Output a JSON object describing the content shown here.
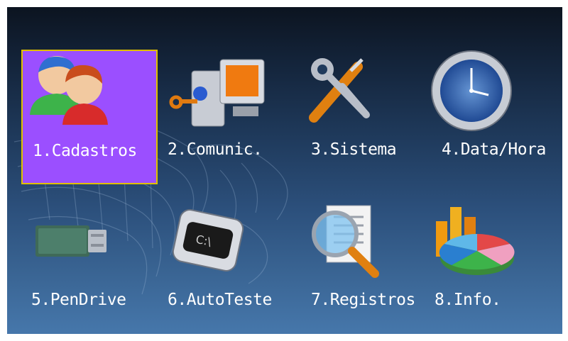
{
  "colors": {
    "selection_fill": "#9b4fff",
    "selection_border": "#e0c000",
    "label_text": "#ffffff",
    "background_top": "#0c1420",
    "background_bottom": "#4677ab"
  },
  "menu": {
    "selected_index": 0,
    "items": [
      {
        "label": "1.Cadastros",
        "icon": "users-icon"
      },
      {
        "label": "2.Comunic.",
        "icon": "network-computer-icon"
      },
      {
        "label": "3.Sistema",
        "icon": "wrench-screwdriver-icon"
      },
      {
        "label": "4.Data/Hora",
        "icon": "clock-icon"
      },
      {
        "label": "5.PenDrive",
        "icon": "usb-drive-icon"
      },
      {
        "label": "6.AutoTeste",
        "icon": "terminal-chip-icon"
      },
      {
        "label": "7.Registros",
        "icon": "magnifier-document-icon"
      },
      {
        "label": "8.Info.",
        "icon": "chart-icon"
      }
    ]
  }
}
